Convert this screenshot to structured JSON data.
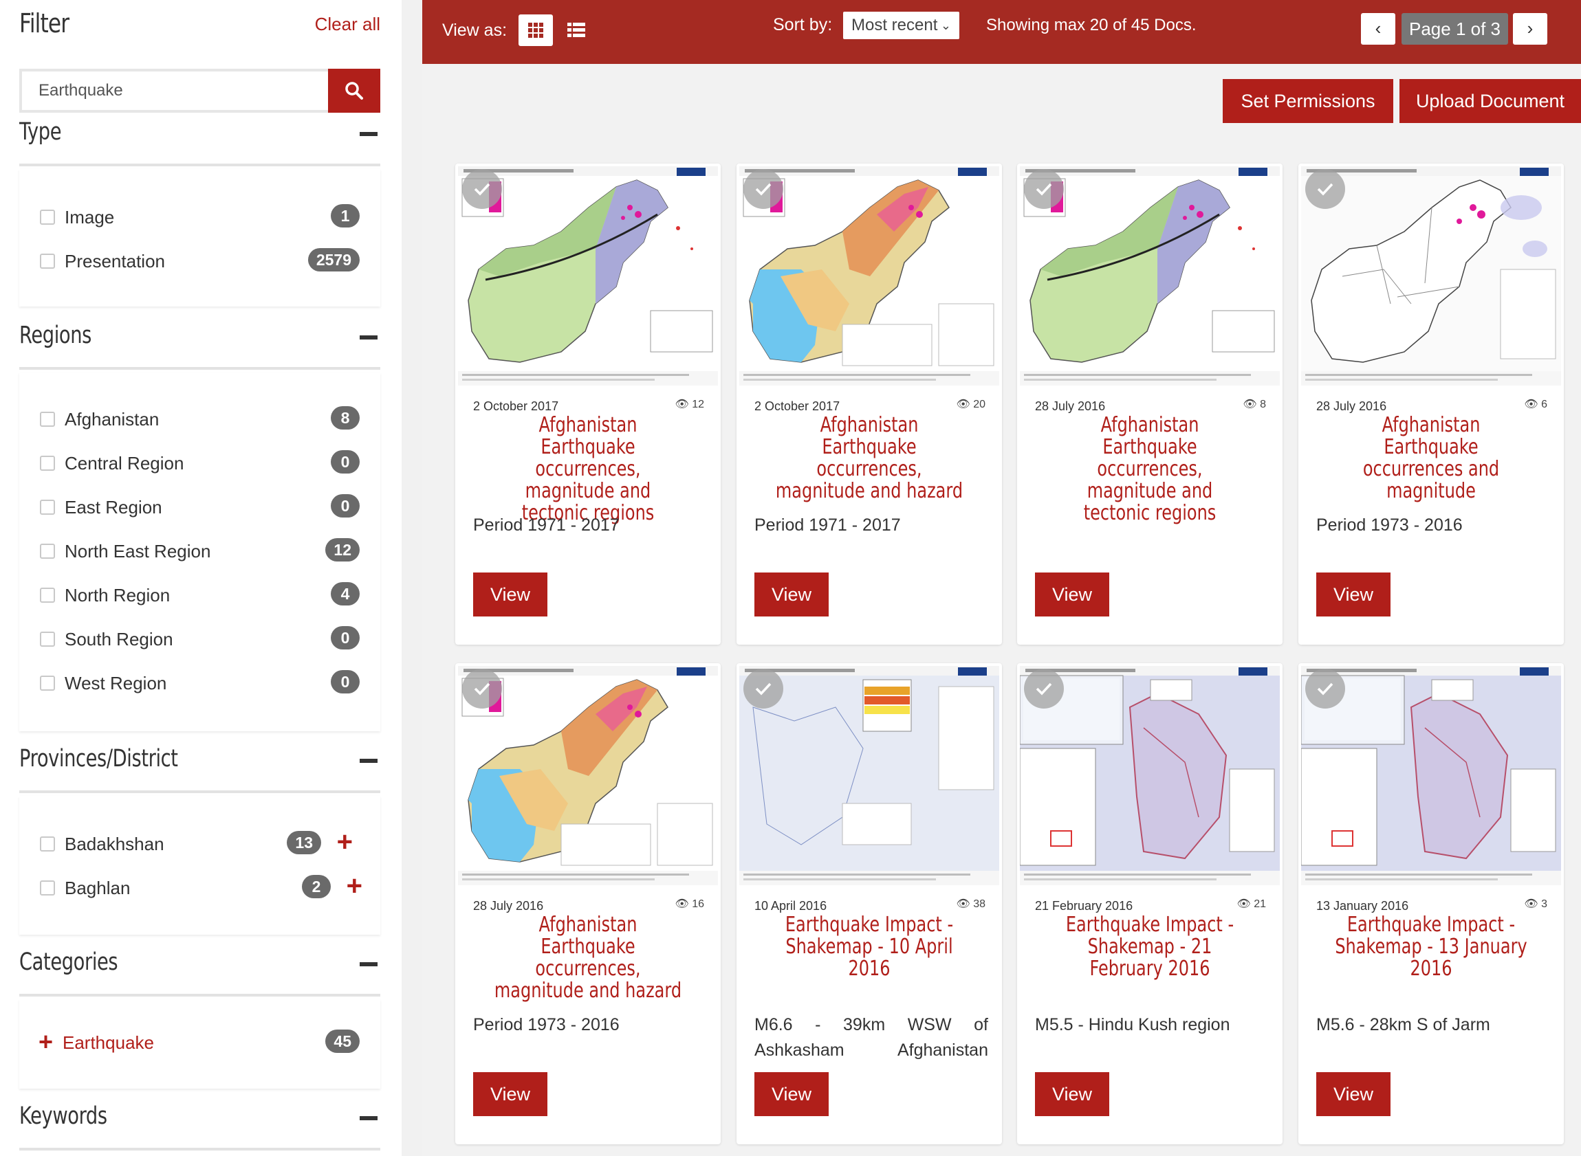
{
  "filter": {
    "title": "Filter",
    "clear_all": "Clear all",
    "search_value": "Earthquake",
    "search_icon": "search-icon"
  },
  "type": {
    "title": "Type",
    "items": [
      {
        "label": "Image",
        "count": "1"
      },
      {
        "label": "Presentation",
        "count": "2579"
      }
    ]
  },
  "regions": {
    "title": "Regions",
    "items": [
      {
        "label": "Afghanistan",
        "count": "8"
      },
      {
        "label": "Central Region",
        "count": "0"
      },
      {
        "label": "East Region",
        "count": "0"
      },
      {
        "label": "North East Region",
        "count": "12"
      },
      {
        "label": "North Region",
        "count": "4"
      },
      {
        "label": "South Region",
        "count": "0"
      },
      {
        "label": "West Region",
        "count": "0"
      }
    ]
  },
  "provinces": {
    "title": "Provinces/District",
    "items": [
      {
        "label": "Badakhshan",
        "count": "13",
        "action": "+"
      },
      {
        "label": "Baghlan",
        "count": "2",
        "action": "+"
      }
    ]
  },
  "categories": {
    "title": "Categories",
    "items": [
      {
        "label": "Earthquake",
        "count": "45",
        "prefix": "+"
      }
    ]
  },
  "keywords": {
    "title": "Keywords"
  },
  "toolbar": {
    "view_as": "View as:",
    "sort_by": "Sort by:",
    "sort_value": "Most recent",
    "showing": "Showing max 20 of 45  Docs.",
    "page_label": "Page 1 of 3",
    "prev": "‹",
    "next": "›"
  },
  "actions": {
    "set_permissions": "Set Permissions",
    "upload_document": "Upload Document"
  },
  "cards": [
    {
      "date": "2 October 2017",
      "views": "12",
      "title": "Afghanistan Earthquake occurrences, magnitude and tectonic regions",
      "desc": "Period 1971 - 2017",
      "button": "View",
      "map": "tectonic"
    },
    {
      "date": "2 October 2017",
      "views": "20",
      "title": "Afghanistan Earthquake occurrences, magnitude and hazard",
      "desc": "Period 1971 - 2017",
      "button": "View",
      "map": "hazard"
    },
    {
      "date": "28 July 2016",
      "views": "8",
      "title": "Afghanistan Earthquake occurrences, magnitude and tectonic regions",
      "desc": "",
      "button": "View",
      "map": "tectonic"
    },
    {
      "date": "28 July 2016",
      "views": "6",
      "title": "Afghanistan Earthquake occurrences and magnitude",
      "desc": "Period 1973 - 2016",
      "button": "View",
      "map": "outline"
    },
    {
      "date": "28 July 2016",
      "views": "16",
      "title": "Afghanistan Earthquake occurrences, magnitude and hazard",
      "desc": "Period 1973 - 2016",
      "button": "View",
      "map": "hazard"
    },
    {
      "date": "10 April 2016",
      "views": "38",
      "title": "Earthquake Impact - Shakemap - 10 April 2016",
      "desc": "M6.6 - 39km WSW of Ashkasham Afghanistan",
      "button": "View",
      "map": "shake1"
    },
    {
      "date": "21 February 2016",
      "views": "21",
      "title": "Earthquake Impact - Shakemap - 21 February 2016",
      "desc": "M5.5 - Hindu Kush region",
      "button": "View",
      "map": "shake2"
    },
    {
      "date": "13 January 2016",
      "views": "3",
      "title": "Earthquake Impact - Shakemap - 13 January 2016",
      "desc": "M5.6 - 28km S of Jarm",
      "button": "View",
      "map": "shake3"
    }
  ],
  "colors": {
    "accent": "#b01f1a",
    "topbar": "#a52a22",
    "badge": "#6a6a6a"
  }
}
